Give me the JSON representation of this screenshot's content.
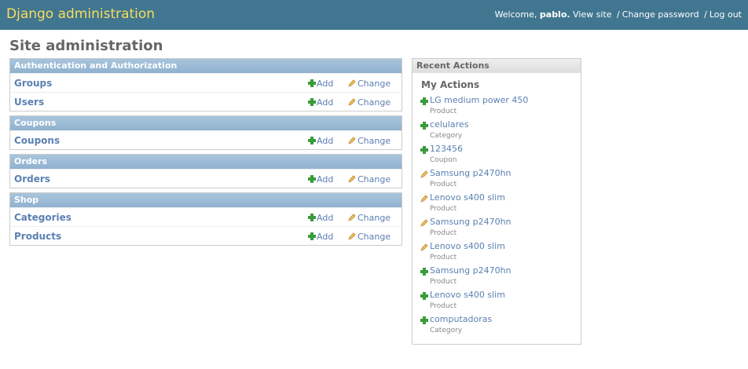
{
  "header": {
    "branding": "Django administration",
    "welcome": "Welcome,",
    "username": "pablo.",
    "view_site": "View site",
    "separator": "/",
    "change_password": "Change password",
    "log_out": "Log out"
  },
  "page_title": "Site administration",
  "apps": [
    {
      "name": "Authentication and Authorization",
      "models": [
        {
          "name": "Groups",
          "add": "Add",
          "change": "Change"
        },
        {
          "name": "Users",
          "add": "Add",
          "change": "Change"
        }
      ]
    },
    {
      "name": "Coupons",
      "models": [
        {
          "name": "Coupons",
          "add": "Add",
          "change": "Change"
        }
      ]
    },
    {
      "name": "Orders",
      "models": [
        {
          "name": "Orders",
          "add": "Add",
          "change": "Change"
        }
      ]
    },
    {
      "name": "Shop",
      "models": [
        {
          "name": "Categories",
          "add": "Add",
          "change": "Change"
        },
        {
          "name": "Products",
          "add": "Add",
          "change": "Change"
        }
      ]
    }
  ],
  "recent_actions": {
    "title": "Recent Actions",
    "subtitle": "My Actions",
    "items": [
      {
        "icon": "plus-icon",
        "title": "LG medium power 450",
        "type": "Product"
      },
      {
        "icon": "plus-icon",
        "title": "celulares",
        "type": "Category"
      },
      {
        "icon": "plus-icon",
        "title": "123456",
        "type": "Coupon"
      },
      {
        "icon": "pencil-icon",
        "title": "Samsung p2470hn",
        "type": "Product"
      },
      {
        "icon": "pencil-icon",
        "title": "Lenovo s400 slim",
        "type": "Product"
      },
      {
        "icon": "pencil-icon",
        "title": "Samsung p2470hn",
        "type": "Product"
      },
      {
        "icon": "pencil-icon",
        "title": "Lenovo s400 slim",
        "type": "Product"
      },
      {
        "icon": "plus-icon",
        "title": "Samsung p2470hn",
        "type": "Product"
      },
      {
        "icon": "plus-icon",
        "title": "Lenovo s400 slim",
        "type": "Product"
      },
      {
        "icon": "plus-icon",
        "title": "computadoras",
        "type": "Category"
      }
    ]
  },
  "colors": {
    "header_bg": "#417690",
    "branding": "#f5dd5d",
    "caption_bg": "#8fb2cf",
    "link": "#5b80b2",
    "add_icon": "#3a9b3a"
  }
}
